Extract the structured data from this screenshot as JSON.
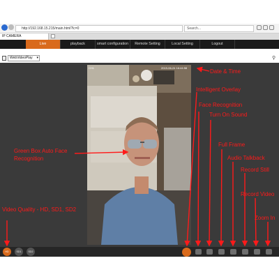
{
  "browser": {
    "url": "http://192.168.15.215/main.html?lc=0",
    "search_placeholder": "Search...",
    "tab_title": "IP CAMERA"
  },
  "nav": {
    "items": [
      "Live",
      "playback",
      "smart configuration",
      "Remote Setting",
      "Local Setting",
      "Logout"
    ],
    "active": "Live"
  },
  "player": {
    "selected": "WebVideoPlay"
  },
  "video": {
    "osd_channel": "CH1",
    "osd_timestamp": "2019-06-24 16:44:58"
  },
  "toolbar": {
    "quality_buttons": [
      "HD",
      "SD1",
      "SD2"
    ],
    "active_quality": "HD"
  },
  "annotations": {
    "date_time": "Date & Time",
    "intelligent_overlay": "Intelligent Overlay",
    "face_recognition": "Face Recognition",
    "turn_on_sound": "Turn On Sound",
    "green_box_line1": "Green Box Auto Face",
    "green_box_line2": "Recognition",
    "full_frame": "Full Frame",
    "audio_talkback": "Audio Talkback",
    "record_still": "Record Still",
    "record_video": "Record Video",
    "zoom_in": "Zoom In",
    "video_quality": "Video Quality - HD, SD1, SD2"
  },
  "colors": {
    "accent": "#d96a1c",
    "annotation": "#ff1a1a",
    "nav_bg": "#1a1a1a",
    "panel_bg": "#3a3a3a"
  }
}
